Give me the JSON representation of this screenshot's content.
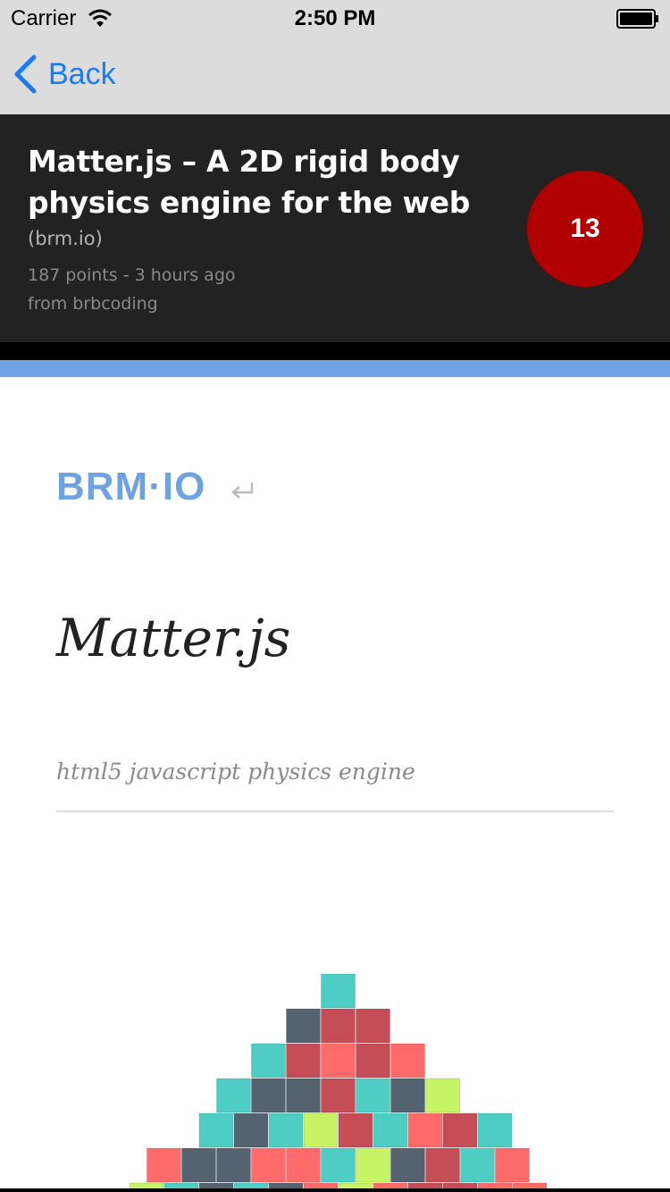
{
  "status_bar": {
    "carrier": "Carrier",
    "time": "2:50 PM"
  },
  "nav": {
    "back_label": "Back"
  },
  "story": {
    "title": "Matter.js – A 2D rigid body physics engine for the web",
    "domain": "(brm.io)",
    "meta": "187 points - 3 hours ago",
    "author": "from brbcoding",
    "comments": "13"
  },
  "web": {
    "logo": "BRM·IO",
    "heading": "Matter.js",
    "subtitle": "html5 javascript physics engine"
  },
  "colors": {
    "accent_blue": "#6da3e3",
    "ios_blue": "#1a7cf4",
    "badge_red": "#b00000",
    "header_bg": "#222222",
    "block_teal": "#4ecdc4",
    "block_slate": "#556270",
    "block_crimson": "#c44d58",
    "block_coral": "#ff6b6b",
    "block_lime": "#c7f464"
  },
  "demo_blocks": {
    "rows": [
      "....T....",
      "...SCC...",
      "..TCRCR..",
      ".TSSCTSL.",
      ".TSTLCTRCT",
      "RSSRRTLSCTR",
      "LTSTSRLRCCRR"
    ],
    "palette": {
      "T": "teal",
      "S": "slate",
      "C": "crimson",
      "R": "coral",
      "L": "lime"
    }
  }
}
